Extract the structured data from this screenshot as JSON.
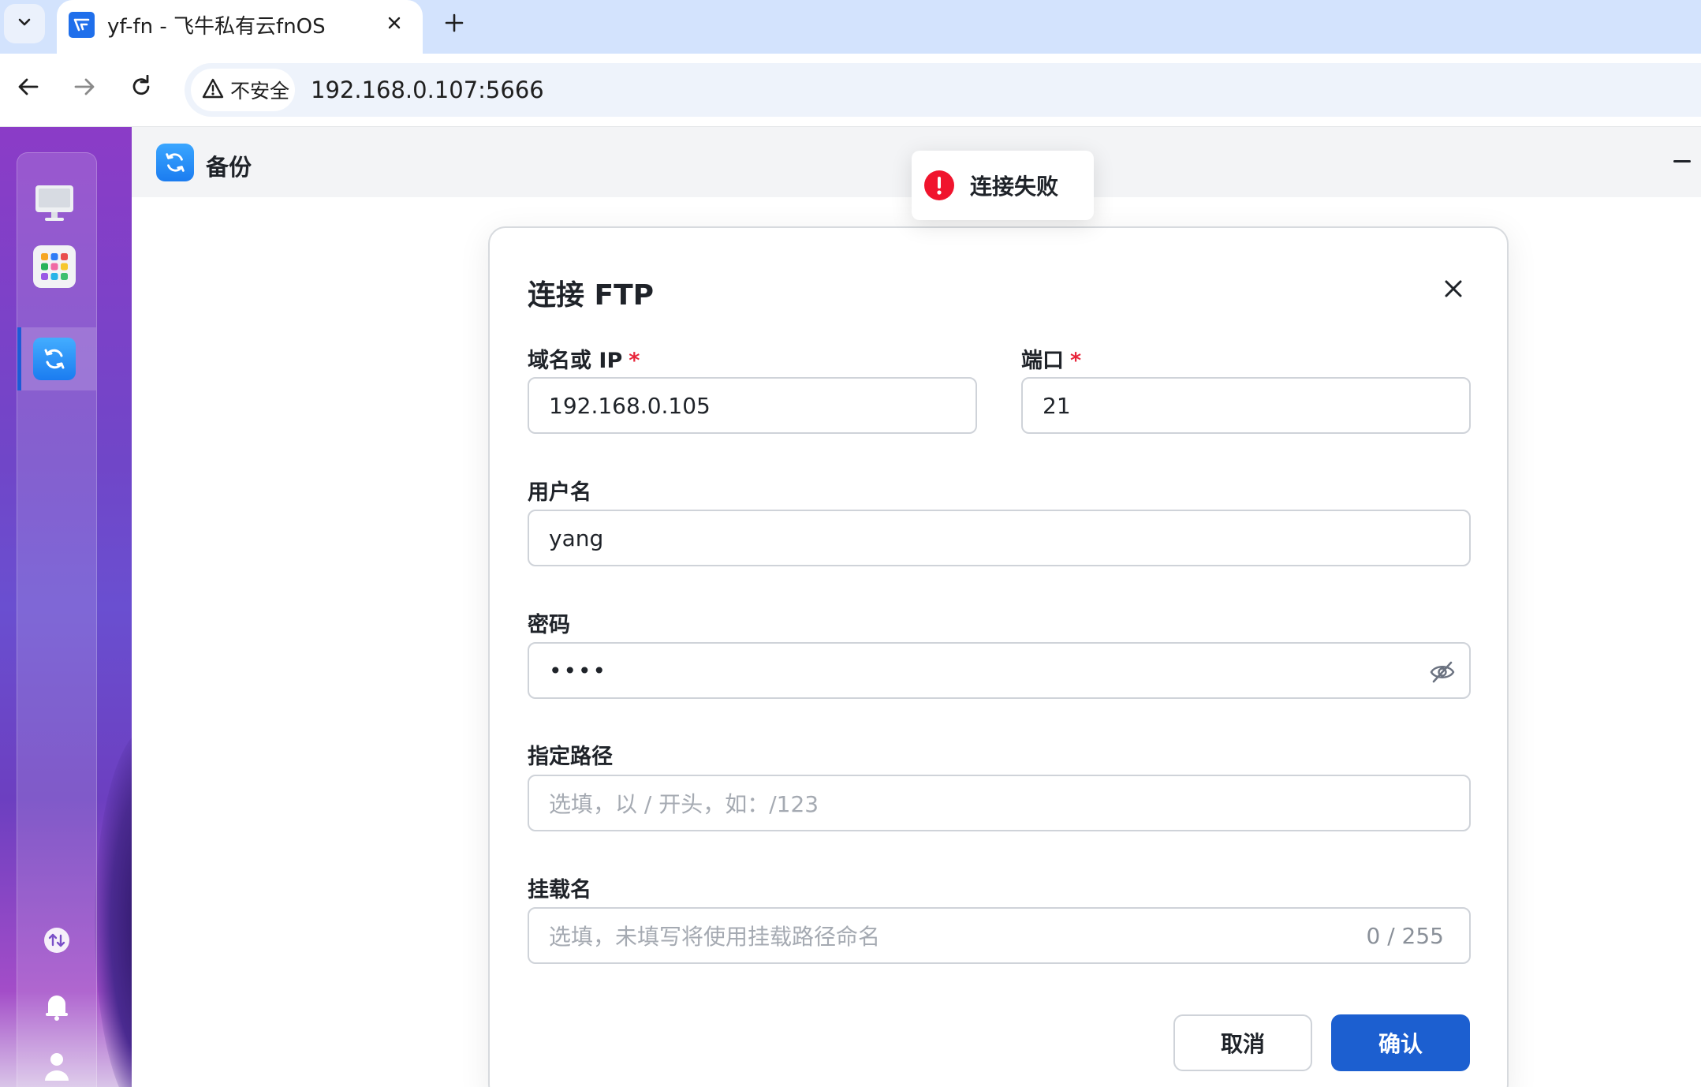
{
  "browser": {
    "tab_title": "yf-fn - 飞牛私有云fnOS",
    "security_label": "不安全",
    "url": "192.168.0.107:5666"
  },
  "app": {
    "title": "备份",
    "accent_color": "#1c5fd0"
  },
  "toast": {
    "message": "连接失败",
    "status_color": "#f0142d"
  },
  "dialog": {
    "title": "连接 FTP",
    "fields": {
      "host": {
        "label": "域名或 IP",
        "required_mark": "*",
        "value": "192.168.0.105"
      },
      "port": {
        "label": "端口",
        "required_mark": "*",
        "value": "21"
      },
      "username": {
        "label": "用户名",
        "value": "yang"
      },
      "password": {
        "label": "密码",
        "value": "••••"
      },
      "path": {
        "label": "指定路径",
        "placeholder": "选填，以 / 开头，如：/123"
      },
      "mount_name": {
        "label": "挂载名",
        "placeholder": "选填，未填写将使用挂载路径命名",
        "counter": "0 / 255"
      }
    },
    "buttons": {
      "cancel": "取消",
      "confirm": "确认"
    }
  }
}
